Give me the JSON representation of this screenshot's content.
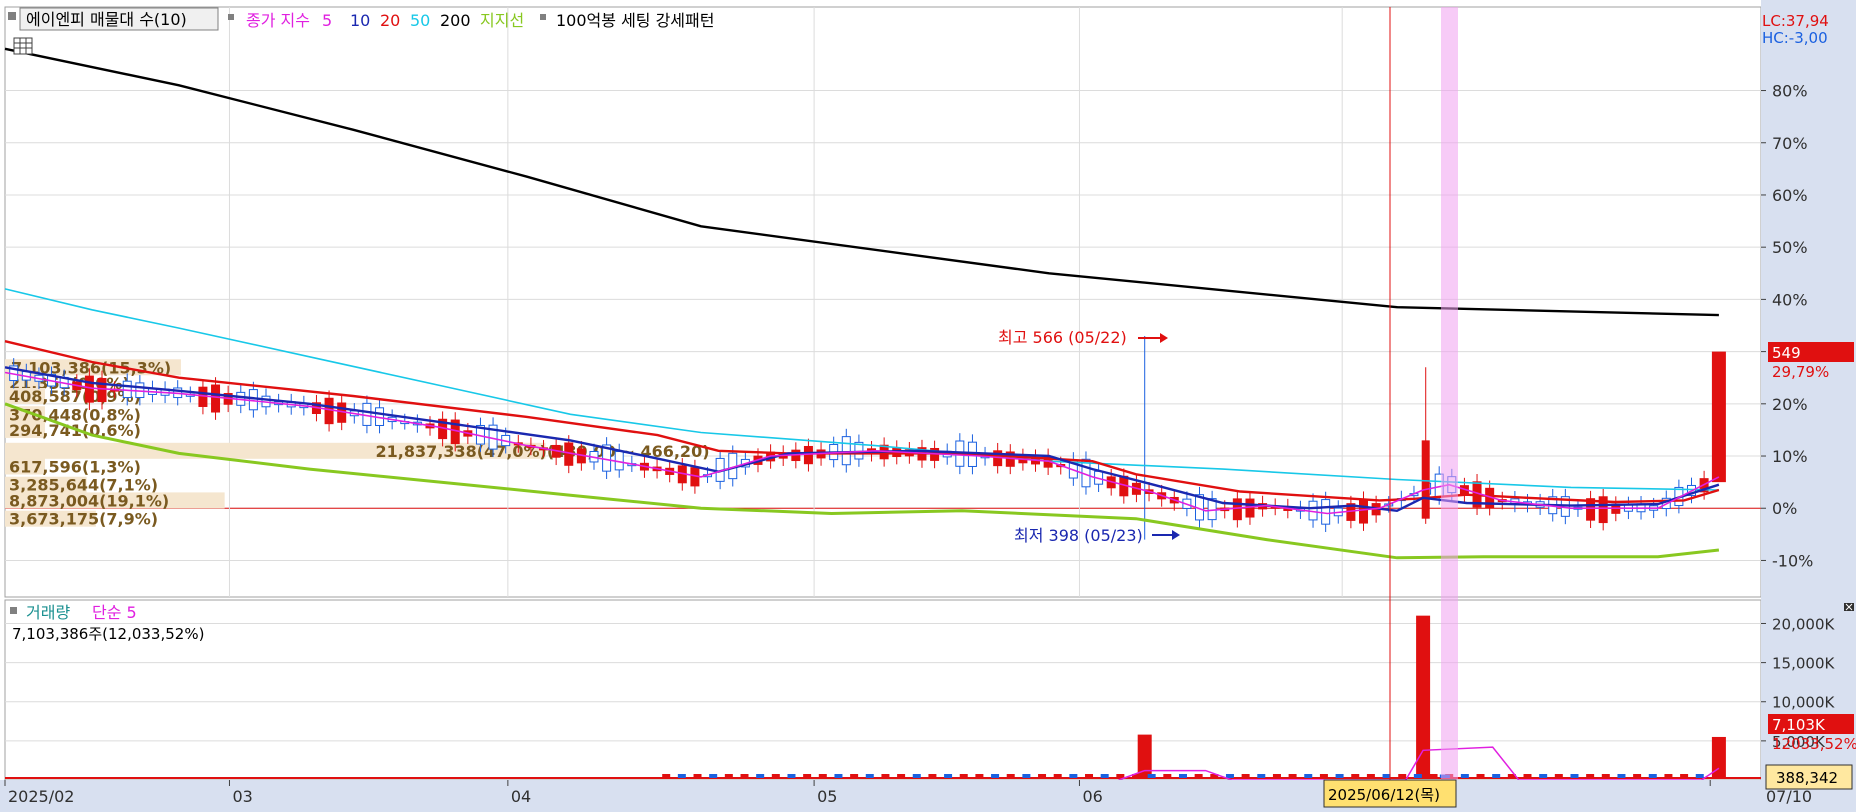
{
  "legend_price": {
    "indicator": "에이엔피 매물대 수(10)",
    "ma_label": "종가 지수",
    "ma_periods": [
      "5",
      "10",
      "20",
      "50",
      "200"
    ],
    "ma_colors": [
      "#e020e0",
      "#1a28b0",
      "#e01010",
      "#18c8e8",
      "#000000"
    ],
    "support": "지지선",
    "pattern": "100억봉 세팅 강세패턴"
  },
  "legend_volume": {
    "name": "거래량",
    "ma": "단순 5",
    "summary": "7,103,386주(12,033,52%)"
  },
  "right_axis": {
    "lc": "LC:37,94",
    "hc": "HC:-3,00",
    "last_price": "549",
    "last_change": "29,79%",
    "vol_last": "7,103K",
    "vol_ratio": "12033,52%",
    "corner_value": "388,342"
  },
  "annotations": {
    "high": "최고 566 (05/22)",
    "low": "최저 398 (05/23)",
    "cursor_date": "2025/06/12(목)"
  },
  "chart_data": [
    {
      "type": "candlestick",
      "title": "",
      "x_tick_labels": [
        "2025/02",
        "03",
        "04",
        "05",
        "06",
        "07",
        "07/10"
      ],
      "y_axis": {
        "scale": "percent",
        "ticks": [
          "80%",
          "70%",
          "60%",
          "50%",
          "40%",
          "30%",
          "20%",
          "10%",
          "0%",
          "-10%"
        ],
        "ylim": [
          -17,
          96
        ]
      },
      "volume_profile": [
        {
          "label": "21,351(0,0%)",
          "level": 24,
          "ratio": 0.0
        },
        {
          "label": "408,587(0,9%)",
          "level": 21.5,
          "ratio": 0.009
        },
        {
          "label": "370,448(0,8%)",
          "level": 18,
          "ratio": 0.008
        },
        {
          "label": "294,741(0,6%)",
          "level": 15,
          "ratio": 0.006
        },
        {
          "label": "617,596(1,3%)",
          "level": 8,
          "ratio": 0.013
        },
        {
          "label": "3,285,644(7,1%)",
          "level": 4.5,
          "ratio": 0.071
        },
        {
          "label": "8,873,004(19,1%)",
          "level": 1.5,
          "ratio": 0.191
        },
        {
          "label": "3,673,175(7,9%)",
          "level": -2,
          "ratio": 0.079
        },
        {
          "label": "7,103,386(15,3%)",
          "level": 27,
          "ratio": 0.153
        },
        {
          "label": "21,837,338(47,0%)(480,00 ~ 466,20)",
          "level": 11,
          "ratio": 0.47
        }
      ],
      "series": [
        {
          "name": "200",
          "role": "ma200",
          "color": "#000000",
          "points": [
            [
              0,
              88
            ],
            [
              0.2,
              81
            ],
            [
              0.4,
              72.5
            ],
            [
              0.6,
              63.5
            ],
            [
              0.8,
              54
            ],
            [
              1.2,
              45
            ],
            [
              1.6,
              38.5
            ],
            [
              1.97,
              37
            ]
          ]
        },
        {
          "name": "50",
          "role": "ma50",
          "color": "#18c8e8",
          "points": [
            [
              0,
              42
            ],
            [
              0.1,
              38
            ],
            [
              0.2,
              34.5
            ],
            [
              0.35,
              29
            ],
            [
              0.5,
              23.5
            ],
            [
              0.65,
              18
            ],
            [
              0.8,
              14.5
            ],
            [
              1.0,
              12
            ],
            [
              1.2,
              9
            ],
            [
              1.4,
              7.5
            ],
            [
              1.6,
              5.5
            ],
            [
              1.8,
              4
            ],
            [
              1.97,
              3.5
            ]
          ]
        },
        {
          "name": "20",
          "role": "ma20",
          "color": "#e01010",
          "points": [
            [
              0,
              32
            ],
            [
              0.1,
              28
            ],
            [
              0.2,
              25
            ],
            [
              0.4,
              21.5
            ],
            [
              0.6,
              17.5
            ],
            [
              0.75,
              14
            ],
            [
              0.82,
              11
            ],
            [
              0.9,
              10.5
            ],
            [
              1.1,
              10.5
            ],
            [
              1.25,
              9
            ],
            [
              1.3,
              6.5
            ],
            [
              1.42,
              3.2
            ],
            [
              1.58,
              1.5
            ],
            [
              1.62,
              1.8
            ],
            [
              1.68,
              2.6
            ],
            [
              1.75,
              2.0
            ],
            [
              1.85,
              1.2
            ],
            [
              1.93,
              1.5
            ],
            [
              1.97,
              3.5
            ]
          ]
        },
        {
          "name": "10",
          "role": "ma10",
          "color": "#1a28b0",
          "points": [
            [
              0,
              27
            ],
            [
              0.1,
              24
            ],
            [
              0.2,
              22.5
            ],
            [
              0.35,
              20
            ],
            [
              0.5,
              16.5
            ],
            [
              0.65,
              13
            ],
            [
              0.75,
              9.5
            ],
            [
              0.82,
              7
            ],
            [
              0.9,
              10.5
            ],
            [
              1.05,
              11
            ],
            [
              1.2,
              10
            ],
            [
              1.25,
              7.5
            ],
            [
              1.32,
              4.5
            ],
            [
              1.4,
              1
            ],
            [
              1.5,
              0
            ],
            [
              1.55,
              0.5
            ],
            [
              1.6,
              -0.5
            ],
            [
              1.63,
              2
            ],
            [
              1.68,
              1
            ],
            [
              1.8,
              0.5
            ],
            [
              1.9,
              0.8
            ],
            [
              1.97,
              4.5
            ]
          ]
        },
        {
          "name": "5",
          "role": "ma5",
          "color": "#e020e0",
          "points": [
            [
              0,
              26
            ],
            [
              0.1,
              23
            ],
            [
              0.2,
              22
            ],
            [
              0.35,
              19.5
            ],
            [
              0.5,
              15.5
            ],
            [
              0.6,
              12
            ],
            [
              0.72,
              8.5
            ],
            [
              0.8,
              6
            ],
            [
              0.88,
              10
            ],
            [
              1.0,
              11
            ],
            [
              1.12,
              10
            ],
            [
              1.2,
              9
            ],
            [
              1.25,
              6
            ],
            [
              1.32,
              3
            ],
            [
              1.38,
              -0.5
            ],
            [
              1.45,
              0.5
            ],
            [
              1.52,
              -1
            ],
            [
              1.58,
              0
            ],
            [
              1.63,
              3.5
            ],
            [
              1.66,
              4.5
            ],
            [
              1.72,
              1.5
            ],
            [
              1.8,
              0
            ],
            [
              1.9,
              0
            ],
            [
              1.97,
              6
            ]
          ]
        },
        {
          "name": "지지선",
          "role": "support",
          "color": "#88c820",
          "points": [
            [
              0,
              20
            ],
            [
              0.1,
              14
            ],
            [
              0.2,
              10.5
            ],
            [
              0.35,
              7.5
            ],
            [
              0.5,
              5
            ],
            [
              0.65,
              2.5
            ],
            [
              0.8,
              0
            ],
            [
              0.95,
              -1
            ],
            [
              1.1,
              -0.5
            ],
            [
              1.3,
              -2
            ],
            [
              1.45,
              -6
            ],
            [
              1.6,
              -9.5
            ],
            [
              1.7,
              -9.3
            ],
            [
              1.9,
              -9.3
            ],
            [
              1.97,
              -8
            ]
          ]
        }
      ]
    },
    {
      "type": "bar",
      "title": "거래량",
      "y_axis": {
        "ticks": [
          "20,000K",
          "15,000K",
          "10,000K",
          "5,000K"
        ],
        "ylim": [
          0,
          23000
        ]
      },
      "series": [
        {
          "name": "거래량",
          "color": "#e01010",
          "bars": [
            [
              1.31,
              5800
            ],
            [
              1.63,
              21000
            ],
            [
              1.97,
              5500
            ]
          ]
        },
        {
          "name": "단순 5",
          "color": "#e020e0",
          "points": [
            [
              1.28,
              0
            ],
            [
              1.31,
              1200
            ],
            [
              1.38,
              1200
            ],
            [
              1.41,
              0
            ],
            [
              1.61,
              0
            ],
            [
              1.63,
              3800
            ],
            [
              1.71,
              4200
            ],
            [
              1.74,
              0
            ],
            [
              1.95,
              0
            ],
            [
              1.97,
              1500
            ]
          ]
        }
      ]
    }
  ]
}
